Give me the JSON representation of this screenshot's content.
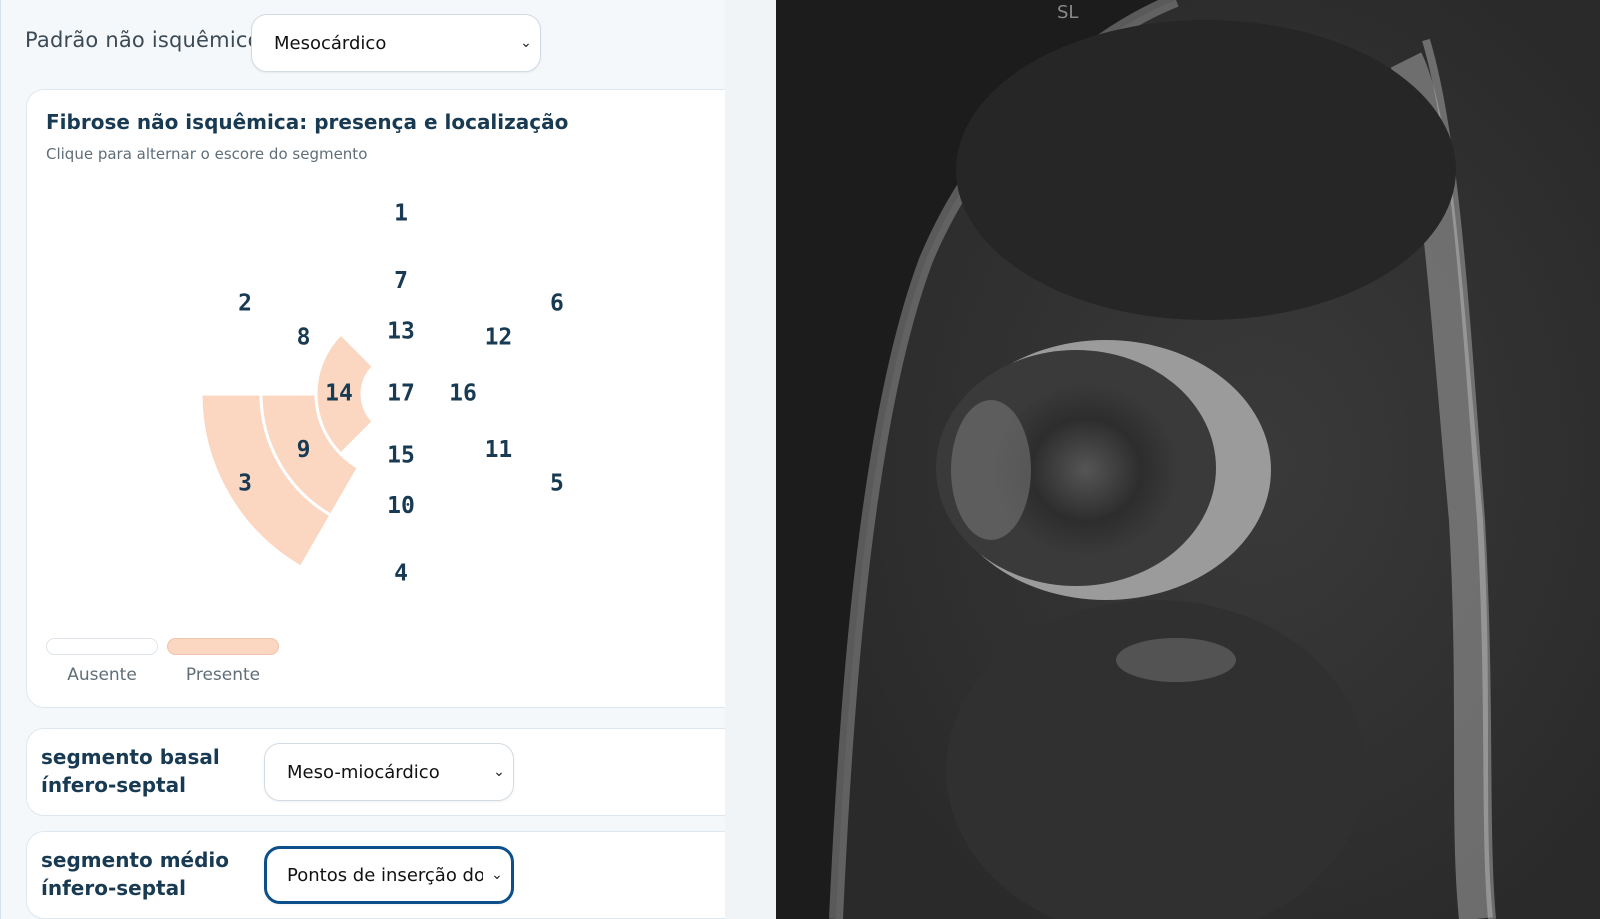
{
  "pattern": {
    "label": "Padrão não isquêmico",
    "selected": "Mesocárdico"
  },
  "fibrose_card": {
    "title": "Fibrose não isquêmica: presença e localização",
    "subtitle": "Clique para alternar o escore do segmento",
    "segments": [
      {
        "id": "1",
        "present": false
      },
      {
        "id": "2",
        "present": false
      },
      {
        "id": "3",
        "present": true
      },
      {
        "id": "4",
        "present": false
      },
      {
        "id": "5",
        "present": false
      },
      {
        "id": "6",
        "present": false
      },
      {
        "id": "7",
        "present": false
      },
      {
        "id": "8",
        "present": false
      },
      {
        "id": "9",
        "present": true
      },
      {
        "id": "10",
        "present": false
      },
      {
        "id": "11",
        "present": false
      },
      {
        "id": "12",
        "present": false
      },
      {
        "id": "13",
        "present": false
      },
      {
        "id": "14",
        "present": true
      },
      {
        "id": "15",
        "present": false
      },
      {
        "id": "16",
        "present": false
      },
      {
        "id": "17",
        "present": false
      }
    ],
    "legend": [
      {
        "label": "Ausente",
        "color": "#ffffff"
      },
      {
        "label": "Presente",
        "color": "#fbd6c0"
      }
    ]
  },
  "segment_rows": [
    {
      "title": "segmento basal ínfero-septal",
      "selected": "Meso-miocárdico",
      "focused": false
    },
    {
      "title": "segmento médio ínfero-septal",
      "selected": "Pontos de inserção do ve",
      "focused": true
    }
  ],
  "viewer": {
    "label": "SL"
  },
  "colors": {
    "present": "#fbd6c0",
    "absent": "#ffffff",
    "title": "#183a52",
    "focus": "#0d4f8b"
  }
}
